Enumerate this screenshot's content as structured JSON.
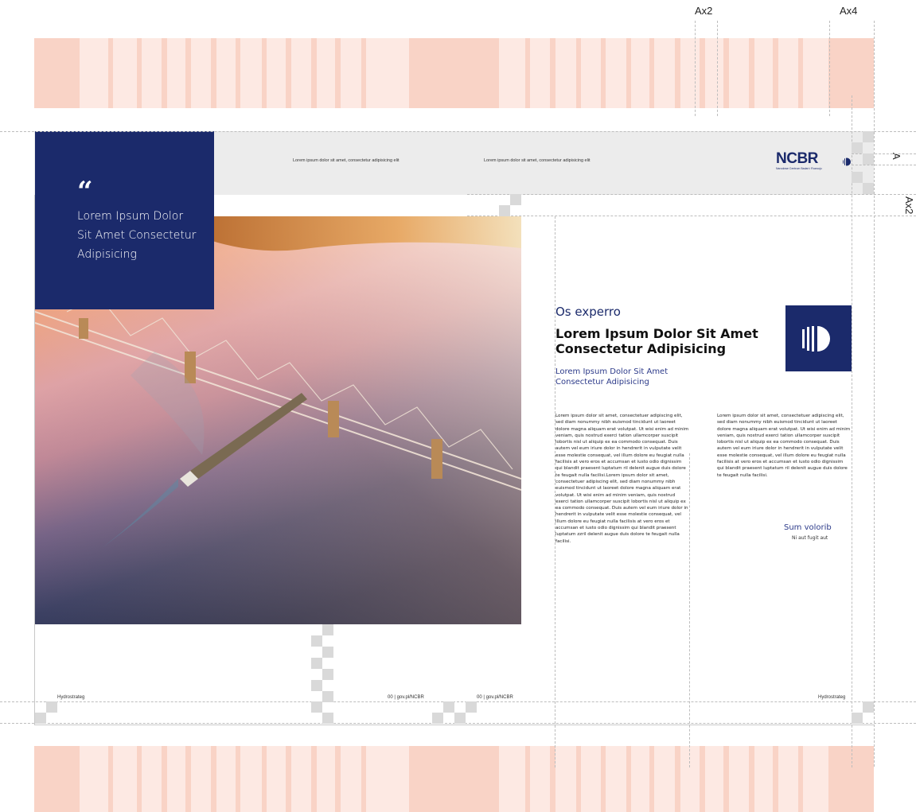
{
  "dimension_labels": {
    "top_ax2": "Ax2",
    "top_ax4": "Ax4",
    "side_a": "A",
    "side_ax2": "Ax2"
  },
  "header": {
    "text_1": "Lorem ipsum dolor sit amet, consectetur adipisicing elit",
    "text_2": "Lorem ipsum dolor sit amet, consectetur adipisicing elit",
    "logo_word": "NCBR",
    "logo_subtitle": "Narodowe Centrum Badań i Rozwoju"
  },
  "quote": {
    "mark": "“",
    "text": "Lorem Ipsum Dolor Sit Amet Consectetur Adipisicing"
  },
  "article": {
    "kicker": "Os experro",
    "headline": "Lorem Ipsum Dolor Sit Amet Consectetur Adipisicing",
    "subhead": "Lorem Ipsum Dolor Sit Amet Consectetur Adipisicing",
    "body_left": "Lorem ipsum dolor sit amet, consectetuer adipiscing elit, sed diam nonummy nibh euismod tincidunt ut laoreet dolore magna aliquam erat volutpat. Ut wisi enim ad minim veniam, quis nostrud exerci tation ullamcorper suscipit lobortis nisl ut aliquip ex ea commodo consequat. Duis autem vel eum iriure dolor in hendrerit in vulputate velit esse molestie consequat, vel illum dolore eu feugiat nulla facilisis at vero eros et accumsan et iusto odio dignissim qui blandit praesent luptatum ril delenit augue duis dolore te feugait nulla facilisi.Lorem ipsum dolor sit amet, consectetuer adipiscing elit, sed diam nonummy nibh euismod tincidunt ut laoreet dolore magna aliquam erat volutpat. Ut wisi enim ad minim veniam, quis nostrud exerci tation ullamcorper suscipit lobortis nisl ut aliquip ex ea commodo consequat. Duis autem vel eum iriure dolor in hendrerit in vulputate velit esse molestie consequat, vel illum dolore eu feugiat nulla facilisis at vero eros et accumsan et iusto odio dignissim qui blandit praesent luptatum zzril delenit augue duis dolore te feugait nulla facilisi.",
    "body_right": "Lorem ipsum dolor sit amet, consectetuer adipiscing elit, sed diam nonummy nibh euismod tincidunt ut laoreet dolore magna aliquam erat volutpat. Ut wisi enim ad minim veniam, quis nostrud exerci tation ullamcorper suscipit lobortis nisl ut aliquip ex ea commodo consequat. Duis autem vel eum iriure dolor in hendrerit in vulputate velit esse molestie consequat, vel illum dolore eu feugiat nulla facilisis at vero eros et accumsan et iusto odio dignissim qui blandit praesent luptatum ril delenit augue duis dolore te feugait nulla facilisi.",
    "caption_title": "Sum volorib",
    "caption_sub": "Ni aut fugit aut"
  },
  "footer": {
    "left": "Hydrostrateg",
    "page_left": "00 | gov.pl/NCBR",
    "page_right": "00 | gov.pl/NCBR",
    "right": "Hydrostrateg"
  },
  "colors": {
    "navy": "#1b2a6b",
    "band_light": "#fde9e3",
    "band_dark": "#f9d3c6",
    "header_gray": "#ececec"
  }
}
